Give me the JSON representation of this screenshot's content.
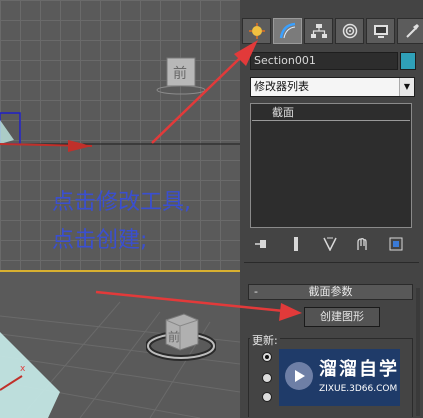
{
  "command_panel": {
    "tabs": [
      {
        "icon": "create-icon",
        "active": false
      },
      {
        "icon": "modify-icon",
        "active": true
      },
      {
        "icon": "hierarchy-icon",
        "active": false
      },
      {
        "icon": "motion-icon",
        "active": false
      },
      {
        "icon": "display-icon",
        "active": false
      },
      {
        "icon": "utilities-icon",
        "active": false
      }
    ],
    "object_name": "Section001",
    "object_color": "#2fa0b8",
    "modifier_list": "修改器列表",
    "modifier_stack": [
      {
        "label": "截面",
        "selected": false
      }
    ],
    "stack_tools": [
      "pin-stack-icon",
      "show-end-result-icon",
      "make-unique-icon",
      "remove-modifier-icon",
      "configure-modifier-sets-icon"
    ]
  },
  "rollout": {
    "collapse_symbol": "-",
    "title": "截面参数",
    "create_shape_button": "创建图形",
    "update_group_label": "更新:",
    "update_options_selected": [
      true,
      false,
      false
    ]
  },
  "viewports": {
    "top_view_cube_label": "前",
    "perspective_view_cube_label": "前",
    "gizmo_axis_label": "x"
  },
  "annotation": {
    "line1": "点击修改工具,",
    "line2": "点击创建;"
  },
  "watermark": {
    "brand": "溜溜自学",
    "url": "ZIXUE.3D66.COM"
  },
  "colors": {
    "annotation_text": "#3a4fd0",
    "arrow": "#e23a3a",
    "active_viewport_border": "#d8b030",
    "section_plane": "#c8ecea"
  }
}
